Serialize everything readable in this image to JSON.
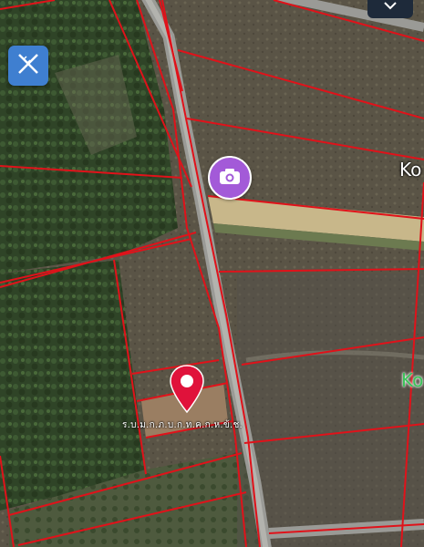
{
  "map": {
    "type": "satellite-parcel-map",
    "boundary_color": "#e0121a",
    "road_color": "#9a9a96",
    "labels": {
      "area_label_white": "Ko",
      "area_label_green": "Ko",
      "parcel_label": "ร.บ.ม.ก.ภ.บ.ก.ท.ค.ก.ห.ข้.ช."
    },
    "markers": {
      "photo_marker": {
        "icon": "camera-icon",
        "color": "#a35ad8"
      },
      "location_pin": {
        "icon": "map-pin-icon",
        "color": "#e0123b"
      }
    },
    "controls": {
      "measure_tool": {
        "icon": "ruler-pencil-icon",
        "color": "#3f7fd0"
      },
      "top_toggle": {
        "icon": "chevron-down-icon",
        "color": "#1e2a3a"
      }
    }
  }
}
